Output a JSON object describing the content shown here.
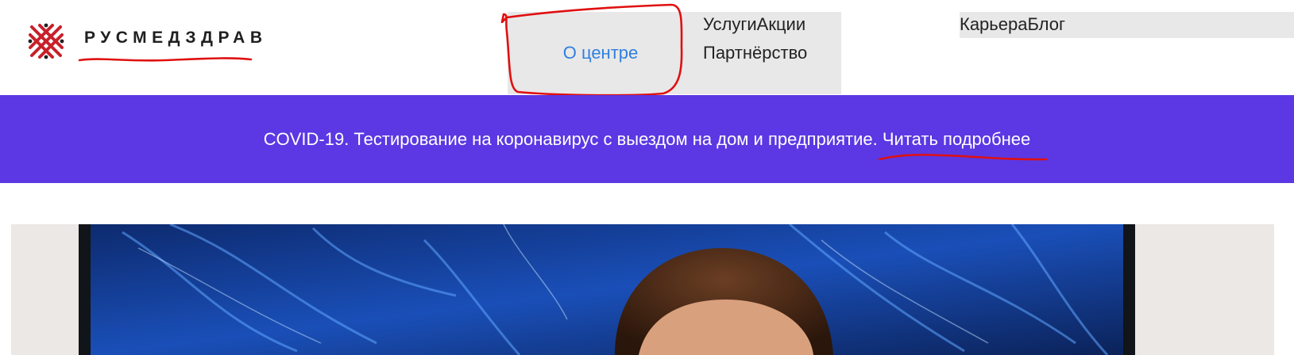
{
  "header": {
    "logo_text": "РУСМЕДЗДРАВ"
  },
  "nav": {
    "about": "О центре",
    "services": "Услуги",
    "promotions": "Акции",
    "partnership": "Партнёрство",
    "career": "Карьера",
    "blog": "Блог"
  },
  "banner": {
    "text": "COVID-19. Тестирование на коронавирус с выездом на дом и предприятие.",
    "link": "Читать подробнее"
  },
  "colors": {
    "banner_bg": "#5b38e3",
    "nav_bg": "#e8e8e8",
    "about_link": "#2f7fe0",
    "annotation": "#e01010",
    "logo_mark": "#c8202a"
  }
}
